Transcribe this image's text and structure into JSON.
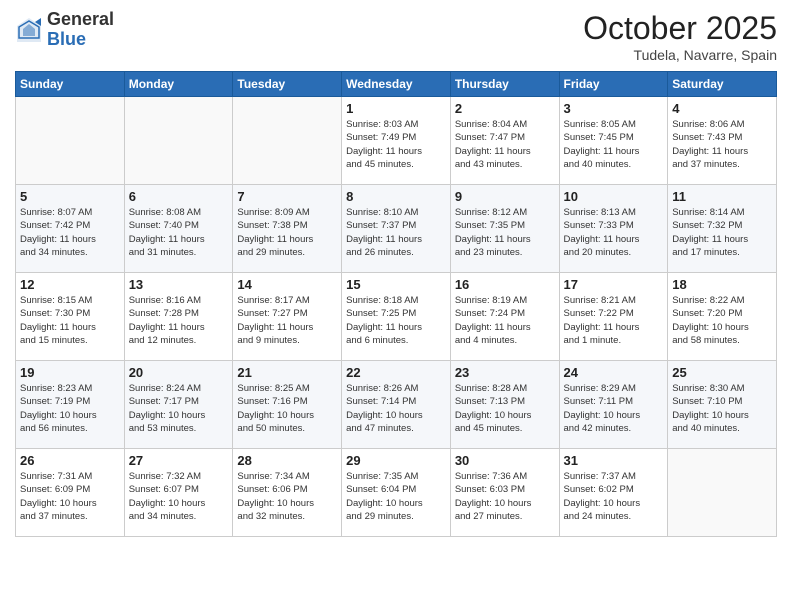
{
  "header": {
    "logo_general": "General",
    "logo_blue": "Blue",
    "month": "October 2025",
    "location": "Tudela, Navarre, Spain"
  },
  "days_of_week": [
    "Sunday",
    "Monday",
    "Tuesday",
    "Wednesday",
    "Thursday",
    "Friday",
    "Saturday"
  ],
  "weeks": [
    [
      {
        "day": "",
        "info": ""
      },
      {
        "day": "",
        "info": ""
      },
      {
        "day": "",
        "info": ""
      },
      {
        "day": "1",
        "info": "Sunrise: 8:03 AM\nSunset: 7:49 PM\nDaylight: 11 hours\nand 45 minutes."
      },
      {
        "day": "2",
        "info": "Sunrise: 8:04 AM\nSunset: 7:47 PM\nDaylight: 11 hours\nand 43 minutes."
      },
      {
        "day": "3",
        "info": "Sunrise: 8:05 AM\nSunset: 7:45 PM\nDaylight: 11 hours\nand 40 minutes."
      },
      {
        "day": "4",
        "info": "Sunrise: 8:06 AM\nSunset: 7:43 PM\nDaylight: 11 hours\nand 37 minutes."
      }
    ],
    [
      {
        "day": "5",
        "info": "Sunrise: 8:07 AM\nSunset: 7:42 PM\nDaylight: 11 hours\nand 34 minutes."
      },
      {
        "day": "6",
        "info": "Sunrise: 8:08 AM\nSunset: 7:40 PM\nDaylight: 11 hours\nand 31 minutes."
      },
      {
        "day": "7",
        "info": "Sunrise: 8:09 AM\nSunset: 7:38 PM\nDaylight: 11 hours\nand 29 minutes."
      },
      {
        "day": "8",
        "info": "Sunrise: 8:10 AM\nSunset: 7:37 PM\nDaylight: 11 hours\nand 26 minutes."
      },
      {
        "day": "9",
        "info": "Sunrise: 8:12 AM\nSunset: 7:35 PM\nDaylight: 11 hours\nand 23 minutes."
      },
      {
        "day": "10",
        "info": "Sunrise: 8:13 AM\nSunset: 7:33 PM\nDaylight: 11 hours\nand 20 minutes."
      },
      {
        "day": "11",
        "info": "Sunrise: 8:14 AM\nSunset: 7:32 PM\nDaylight: 11 hours\nand 17 minutes."
      }
    ],
    [
      {
        "day": "12",
        "info": "Sunrise: 8:15 AM\nSunset: 7:30 PM\nDaylight: 11 hours\nand 15 minutes."
      },
      {
        "day": "13",
        "info": "Sunrise: 8:16 AM\nSunset: 7:28 PM\nDaylight: 11 hours\nand 12 minutes."
      },
      {
        "day": "14",
        "info": "Sunrise: 8:17 AM\nSunset: 7:27 PM\nDaylight: 11 hours\nand 9 minutes."
      },
      {
        "day": "15",
        "info": "Sunrise: 8:18 AM\nSunset: 7:25 PM\nDaylight: 11 hours\nand 6 minutes."
      },
      {
        "day": "16",
        "info": "Sunrise: 8:19 AM\nSunset: 7:24 PM\nDaylight: 11 hours\nand 4 minutes."
      },
      {
        "day": "17",
        "info": "Sunrise: 8:21 AM\nSunset: 7:22 PM\nDaylight: 11 hours\nand 1 minute."
      },
      {
        "day": "18",
        "info": "Sunrise: 8:22 AM\nSunset: 7:20 PM\nDaylight: 10 hours\nand 58 minutes."
      }
    ],
    [
      {
        "day": "19",
        "info": "Sunrise: 8:23 AM\nSunset: 7:19 PM\nDaylight: 10 hours\nand 56 minutes."
      },
      {
        "day": "20",
        "info": "Sunrise: 8:24 AM\nSunset: 7:17 PM\nDaylight: 10 hours\nand 53 minutes."
      },
      {
        "day": "21",
        "info": "Sunrise: 8:25 AM\nSunset: 7:16 PM\nDaylight: 10 hours\nand 50 minutes."
      },
      {
        "day": "22",
        "info": "Sunrise: 8:26 AM\nSunset: 7:14 PM\nDaylight: 10 hours\nand 47 minutes."
      },
      {
        "day": "23",
        "info": "Sunrise: 8:28 AM\nSunset: 7:13 PM\nDaylight: 10 hours\nand 45 minutes."
      },
      {
        "day": "24",
        "info": "Sunrise: 8:29 AM\nSunset: 7:11 PM\nDaylight: 10 hours\nand 42 minutes."
      },
      {
        "day": "25",
        "info": "Sunrise: 8:30 AM\nSunset: 7:10 PM\nDaylight: 10 hours\nand 40 minutes."
      }
    ],
    [
      {
        "day": "26",
        "info": "Sunrise: 7:31 AM\nSunset: 6:09 PM\nDaylight: 10 hours\nand 37 minutes."
      },
      {
        "day": "27",
        "info": "Sunrise: 7:32 AM\nSunset: 6:07 PM\nDaylight: 10 hours\nand 34 minutes."
      },
      {
        "day": "28",
        "info": "Sunrise: 7:34 AM\nSunset: 6:06 PM\nDaylight: 10 hours\nand 32 minutes."
      },
      {
        "day": "29",
        "info": "Sunrise: 7:35 AM\nSunset: 6:04 PM\nDaylight: 10 hours\nand 29 minutes."
      },
      {
        "day": "30",
        "info": "Sunrise: 7:36 AM\nSunset: 6:03 PM\nDaylight: 10 hours\nand 27 minutes."
      },
      {
        "day": "31",
        "info": "Sunrise: 7:37 AM\nSunset: 6:02 PM\nDaylight: 10 hours\nand 24 minutes."
      },
      {
        "day": "",
        "info": ""
      }
    ]
  ]
}
